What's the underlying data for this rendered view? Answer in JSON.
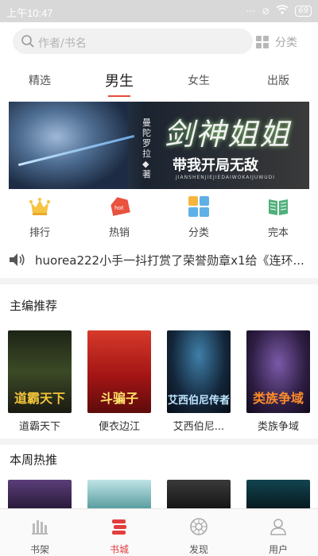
{
  "status_bar": {
    "time": "上午10:47",
    "battery": "69"
  },
  "search": {
    "placeholder": "作者/书名",
    "category_label": "分类"
  },
  "tabs": [
    {
      "label": "精选"
    },
    {
      "label": "男生"
    },
    {
      "label": "女生"
    },
    {
      "label": "出版"
    }
  ],
  "active_tab": "男生",
  "banner": {
    "title": "剑神姐姐",
    "author": "曼陀罗拉◆著",
    "subtitle": "带我开局无敌",
    "pinyin": "JIANSHENJIEJIEDAIWOKAIJUWUDI"
  },
  "categories": [
    {
      "label": "排行",
      "icon": "crown-icon"
    },
    {
      "label": "热销",
      "icon": "hot-tag-icon"
    },
    {
      "label": "分类",
      "icon": "category-grid-icon"
    },
    {
      "label": "完本",
      "icon": "open-book-icon"
    }
  ],
  "marquee": {
    "text": "huorea222小手一抖打赏了荣誉勋章x1给《连环..."
  },
  "sections": {
    "editor_pick": "主编推荐",
    "weekly_hot": "本周热推"
  },
  "editor_books": [
    {
      "name": "道霸天下",
      "cover_text": "道霸天下",
      "cover_color": "#2f3a20"
    },
    {
      "name": "便衣边江",
      "cover_text": "斗骗子",
      "cover_color": "#b81d1d"
    },
    {
      "name": "艾西伯尼...",
      "cover_text": "艾西伯尼传者",
      "cover_color": "#12202e"
    },
    {
      "name": "类族争域",
      "cover_text": "类族争域",
      "cover_color": "#2a1e3a"
    }
  ],
  "weekly_covers": [
    "#3b2a52",
    "#8fc7c9",
    "#2b2b2b",
    "#0e2a30"
  ],
  "bottom_nav": [
    {
      "label": "书架",
      "icon": "bookshelf-icon"
    },
    {
      "label": "书城",
      "icon": "bookstore-icon"
    },
    {
      "label": "发现",
      "icon": "discover-icon"
    },
    {
      "label": "用户",
      "icon": "user-icon"
    }
  ],
  "active_nav": "书城",
  "colors": {
    "accent": "#e23e3e"
  }
}
